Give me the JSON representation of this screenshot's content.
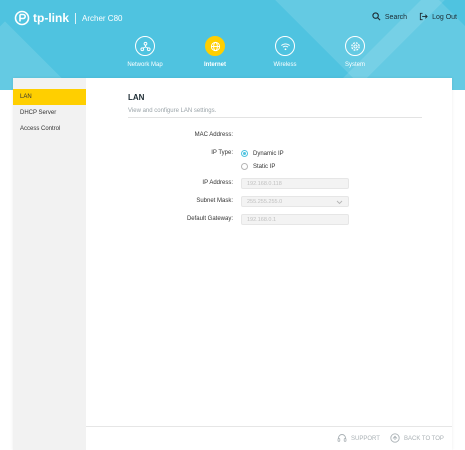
{
  "brand": {
    "name": "tp-link",
    "model": "Archer C80"
  },
  "top_actions": [
    {
      "label": "Search",
      "icon": "search-icon"
    },
    {
      "label": "Log Out",
      "icon": "logout-icon"
    }
  ],
  "nav": [
    {
      "label": "Network Map",
      "icon": "network-map-icon",
      "active": false
    },
    {
      "label": "Internet",
      "icon": "globe-icon",
      "active": true
    },
    {
      "label": "Wireless",
      "icon": "wifi-icon",
      "active": false
    },
    {
      "label": "System",
      "icon": "gear-icon",
      "active": false
    }
  ],
  "sidebar": {
    "items": [
      {
        "label": "LAN",
        "active": true
      },
      {
        "label": "DHCP Server",
        "active": false
      },
      {
        "label": "Access Control",
        "active": false
      }
    ]
  },
  "section": {
    "title": "LAN",
    "subtitle": "View and configure LAN settings."
  },
  "form": {
    "mac_address_label": "MAC Address:",
    "mac_address_value": "",
    "ip_type_label": "IP Type:",
    "ip_type_options": [
      "Dynamic IP",
      "Static IP"
    ],
    "ip_type_selected": "Dynamic IP",
    "ip_address_label": "IP Address:",
    "ip_address_value": "192.168.0.118",
    "subnet_mask_label": "Subnet Mask:",
    "subnet_mask_value": "255.255.255.0",
    "gateway_label": "Default Gateway:",
    "gateway_value": "192.168.0.1"
  },
  "footer": {
    "support": "SUPPORT",
    "back_to_top": "BACK TO TOP"
  },
  "colors": {
    "header": "#4fc3e0",
    "accent": "#ffcf00",
    "radio": "#4fc3e0"
  }
}
